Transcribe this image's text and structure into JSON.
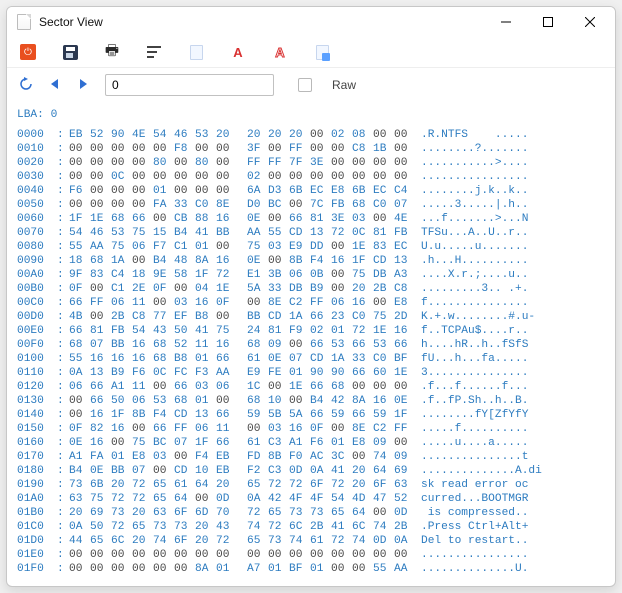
{
  "window": {
    "title": "Sector View"
  },
  "toolbar": {
    "power": "⏻",
    "print": "🖶"
  },
  "nav": {
    "addr_value": "0",
    "raw_label": "Raw"
  },
  "lba_label": "LBA: 0",
  "offsets": [
    "0000",
    "0010",
    "0020",
    "0030",
    "0040",
    "0050",
    "0060",
    "0070",
    "0080",
    "0090",
    "00A0",
    "00B0",
    "00C0",
    "00D0",
    "00E0",
    "00F0",
    "0100",
    "0110",
    "0120",
    "0130",
    "0140",
    "0150",
    "0160",
    "0170",
    "0180",
    "0190",
    "01A0",
    "01B0",
    "01C0",
    "01D0",
    "01E0",
    "01F0"
  ],
  "hex": [
    [
      "EB",
      "52",
      "90",
      "4E",
      "54",
      "46",
      "53",
      "20",
      "20",
      "20",
      "20",
      "00",
      "02",
      "08",
      "00",
      "00"
    ],
    [
      "00",
      "00",
      "00",
      "00",
      "00",
      "F8",
      "00",
      "00",
      "3F",
      "00",
      "FF",
      "00",
      "00",
      "C8",
      "1B",
      "00"
    ],
    [
      "00",
      "00",
      "00",
      "00",
      "80",
      "00",
      "80",
      "00",
      "FF",
      "FF",
      "7F",
      "3E",
      "00",
      "00",
      "00",
      "00"
    ],
    [
      "00",
      "00",
      "0C",
      "00",
      "00",
      "00",
      "00",
      "00",
      "02",
      "00",
      "00",
      "00",
      "00",
      "00",
      "00",
      "00"
    ],
    [
      "F6",
      "00",
      "00",
      "00",
      "01",
      "00",
      "00",
      "00",
      "6A",
      "D3",
      "6B",
      "EC",
      "E8",
      "6B",
      "EC",
      "C4"
    ],
    [
      "00",
      "00",
      "00",
      "00",
      "FA",
      "33",
      "C0",
      "8E",
      "D0",
      "BC",
      "00",
      "7C",
      "FB",
      "68",
      "C0",
      "07"
    ],
    [
      "1F",
      "1E",
      "68",
      "66",
      "00",
      "CB",
      "88",
      "16",
      "0E",
      "00",
      "66",
      "81",
      "3E",
      "03",
      "00",
      "4E"
    ],
    [
      "54",
      "46",
      "53",
      "75",
      "15",
      "B4",
      "41",
      "BB",
      "AA",
      "55",
      "CD",
      "13",
      "72",
      "0C",
      "81",
      "FB"
    ],
    [
      "55",
      "AA",
      "75",
      "06",
      "F7",
      "C1",
      "01",
      "00",
      "75",
      "03",
      "E9",
      "DD",
      "00",
      "1E",
      "83",
      "EC"
    ],
    [
      "18",
      "68",
      "1A",
      "00",
      "B4",
      "48",
      "8A",
      "16",
      "0E",
      "00",
      "8B",
      "F4",
      "16",
      "1F",
      "CD",
      "13"
    ],
    [
      "9F",
      "83",
      "C4",
      "18",
      "9E",
      "58",
      "1F",
      "72",
      "E1",
      "3B",
      "06",
      "0B",
      "00",
      "75",
      "DB",
      "A3"
    ],
    [
      "0F",
      "00",
      "C1",
      "2E",
      "0F",
      "00",
      "04",
      "1E",
      "5A",
      "33",
      "DB",
      "B9",
      "00",
      "20",
      "2B",
      "C8"
    ],
    [
      "66",
      "FF",
      "06",
      "11",
      "00",
      "03",
      "16",
      "0F",
      "00",
      "8E",
      "C2",
      "FF",
      "06",
      "16",
      "00",
      "E8"
    ],
    [
      "4B",
      "00",
      "2B",
      "C8",
      "77",
      "EF",
      "B8",
      "00",
      "BB",
      "CD",
      "1A",
      "66",
      "23",
      "C0",
      "75",
      "2D"
    ],
    [
      "66",
      "81",
      "FB",
      "54",
      "43",
      "50",
      "41",
      "75",
      "24",
      "81",
      "F9",
      "02",
      "01",
      "72",
      "1E",
      "16"
    ],
    [
      "68",
      "07",
      "BB",
      "16",
      "68",
      "52",
      "11",
      "16",
      "68",
      "09",
      "00",
      "66",
      "53",
      "66",
      "53",
      "66"
    ],
    [
      "55",
      "16",
      "16",
      "16",
      "68",
      "B8",
      "01",
      "66",
      "61",
      "0E",
      "07",
      "CD",
      "1A",
      "33",
      "C0",
      "BF"
    ],
    [
      "0A",
      "13",
      "B9",
      "F6",
      "0C",
      "FC",
      "F3",
      "AA",
      "E9",
      "FE",
      "01",
      "90",
      "90",
      "66",
      "60",
      "1E"
    ],
    [
      "06",
      "66",
      "A1",
      "11",
      "00",
      "66",
      "03",
      "06",
      "1C",
      "00",
      "1E",
      "66",
      "68",
      "00",
      "00",
      "00"
    ],
    [
      "00",
      "66",
      "50",
      "06",
      "53",
      "68",
      "01",
      "00",
      "68",
      "10",
      "00",
      "B4",
      "42",
      "8A",
      "16",
      "0E"
    ],
    [
      "00",
      "16",
      "1F",
      "8B",
      "F4",
      "CD",
      "13",
      "66",
      "59",
      "5B",
      "5A",
      "66",
      "59",
      "66",
      "59",
      "1F"
    ],
    [
      "0F",
      "82",
      "16",
      "00",
      "66",
      "FF",
      "06",
      "11",
      "00",
      "03",
      "16",
      "0F",
      "00",
      "8E",
      "C2",
      "FF"
    ],
    [
      "0E",
      "16",
      "00",
      "75",
      "BC",
      "07",
      "1F",
      "66",
      "61",
      "C3",
      "A1",
      "F6",
      "01",
      "E8",
      "09",
      "00"
    ],
    [
      "A1",
      "FA",
      "01",
      "E8",
      "03",
      "00",
      "F4",
      "EB",
      "FD",
      "8B",
      "F0",
      "AC",
      "3C",
      "00",
      "74",
      "09"
    ],
    [
      "B4",
      "0E",
      "BB",
      "07",
      "00",
      "CD",
      "10",
      "EB",
      "F2",
      "C3",
      "0D",
      "0A",
      "41",
      "20",
      "64",
      "69"
    ],
    [
      "73",
      "6B",
      "20",
      "72",
      "65",
      "61",
      "64",
      "20",
      "65",
      "72",
      "72",
      "6F",
      "72",
      "20",
      "6F",
      "63"
    ],
    [
      "63",
      "75",
      "72",
      "72",
      "65",
      "64",
      "00",
      "0D",
      "0A",
      "42",
      "4F",
      "4F",
      "54",
      "4D",
      "47",
      "52"
    ],
    [
      "20",
      "69",
      "73",
      "20",
      "63",
      "6F",
      "6D",
      "70",
      "72",
      "65",
      "73",
      "73",
      "65",
      "64",
      "00",
      "0D"
    ],
    [
      "0A",
      "50",
      "72",
      "65",
      "73",
      "73",
      "20",
      "43",
      "74",
      "72",
      "6C",
      "2B",
      "41",
      "6C",
      "74",
      "2B"
    ],
    [
      "44",
      "65",
      "6C",
      "20",
      "74",
      "6F",
      "20",
      "72",
      "65",
      "73",
      "74",
      "61",
      "72",
      "74",
      "0D",
      "0A"
    ],
    [
      "00",
      "00",
      "00",
      "00",
      "00",
      "00",
      "00",
      "00",
      "00",
      "00",
      "00",
      "00",
      "00",
      "00",
      "00",
      "00"
    ],
    [
      "00",
      "00",
      "00",
      "00",
      "00",
      "00",
      "8A",
      "01",
      "A7",
      "01",
      "BF",
      "01",
      "00",
      "00",
      "55",
      "AA"
    ]
  ],
  "ascii": [
    ".R.NTFS    .....",
    "........?.......",
    "...........>....",
    "................",
    "........j.k..k..",
    ".....3.....|.h..",
    "...f.......>...N",
    "TFSu...A..U..r..",
    "U.u.....u.......",
    ".h...H..........",
    "....X.r.;....u..",
    ".........3.. .+.",
    "f...............",
    "K.+.w........#.u-",
    "f..TCPAu$....r..",
    "h....hR..h..fSfS",
    "fU...h...fa.....",
    "3...............",
    ".f...f......f...",
    ".f..fP.Sh..h..B.",
    "........fY[ZfYfY",
    ".....f..........",
    ".....u....a.....",
    "...............t",
    "..............A.di",
    "sk read error oc",
    "curred...BOOTMGR",
    " is compressed..",
    ".Press Ctrl+Alt+",
    "Del to restart..",
    "................",
    "..............U."
  ]
}
